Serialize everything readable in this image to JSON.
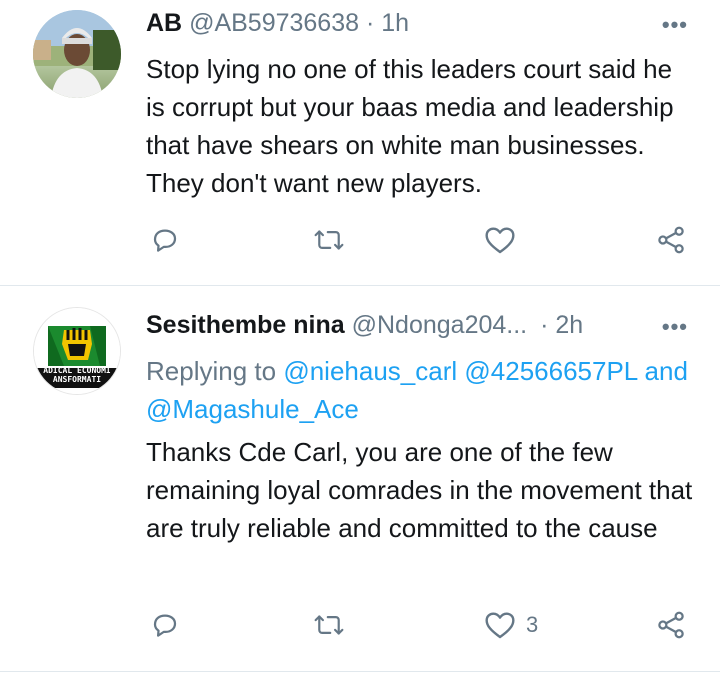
{
  "tweets": [
    {
      "name": "AB",
      "handle": "@AB59736638",
      "time": "· 1h",
      "more": "•••",
      "text": "Stop lying no one of this leaders court said he is corrupt but your baas media and leadership that have shears on white man businesses. They don't want new players.",
      "like_count": ""
    },
    {
      "name": "Sesithembe nina",
      "handle": "@Ndonga204...",
      "time": "· 2h",
      "more": "•••",
      "replying_prefix": "Replying to",
      "mention1": "@niehaus_carl",
      "mention2": "@42566657PL",
      "and_word": "and",
      "mention3": "@Magashule_Ace",
      "text": "Thanks Cde Carl, you are one of the few remaining loyal comrades in the movement that are truly reliable and committed to the cause",
      "like_count": "3",
      "avatar_text_1": "ADICAL ECONOMI",
      "avatar_text_2": "ANSFORMATI"
    }
  ],
  "icons": {
    "reply": "reply-icon",
    "retweet": "retweet-icon",
    "like": "heart-icon",
    "share": "share-icon"
  },
  "colors": {
    "text": "#14171a",
    "secondary": "#657786",
    "link": "#1da1f2",
    "divider": "#e1e8ed"
  }
}
